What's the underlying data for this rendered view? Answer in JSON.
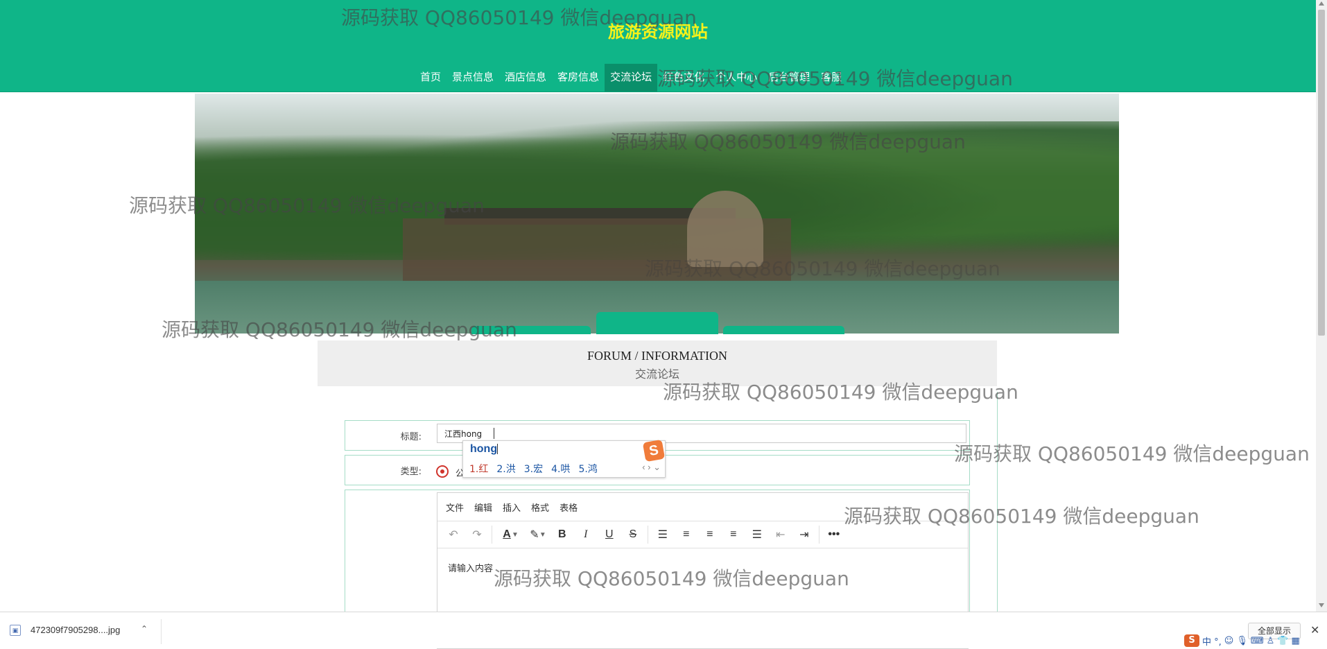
{
  "site": {
    "title": "旅游资源网站"
  },
  "nav": {
    "items": [
      {
        "label": "首页"
      },
      {
        "label": "景点信息"
      },
      {
        "label": "酒店信息"
      },
      {
        "label": "客房信息"
      },
      {
        "label": "交流论坛",
        "active": true
      },
      {
        "label": "红色文化"
      },
      {
        "label": "个人中心"
      },
      {
        "label": "后台管理"
      },
      {
        "label": "客服"
      }
    ]
  },
  "section": {
    "title_en": "FORUM / INFORMATION",
    "title_cn": "交流论坛"
  },
  "form": {
    "title_label": "标题:",
    "title_value": "江西hong",
    "type_label": "类型:",
    "type_option": "公",
    "ime": {
      "input": "hong",
      "logo": "S",
      "candidates": [
        "1.红",
        "2.洪",
        "3.宏",
        "4.哄",
        "5.鸿"
      ],
      "arrows": "‹ › ⌄"
    },
    "editor": {
      "menu": [
        "文件",
        "编辑",
        "插入",
        "格式",
        "表格"
      ],
      "placeholder": "请输入内容"
    }
  },
  "download": {
    "filename": "472309f7905298....jpg",
    "show_all": "全部显示"
  },
  "tray": {
    "ime_mode": "中 °,"
  },
  "watermark": "源码获取 QQ86050149 微信deepguan",
  "colors": {
    "header_green": "#0fb588",
    "title_yellow": "#f7f21a",
    "active_nav": "#0a8f6a",
    "form_border": "#a5dcc6",
    "radio_red": "#d0342c"
  }
}
